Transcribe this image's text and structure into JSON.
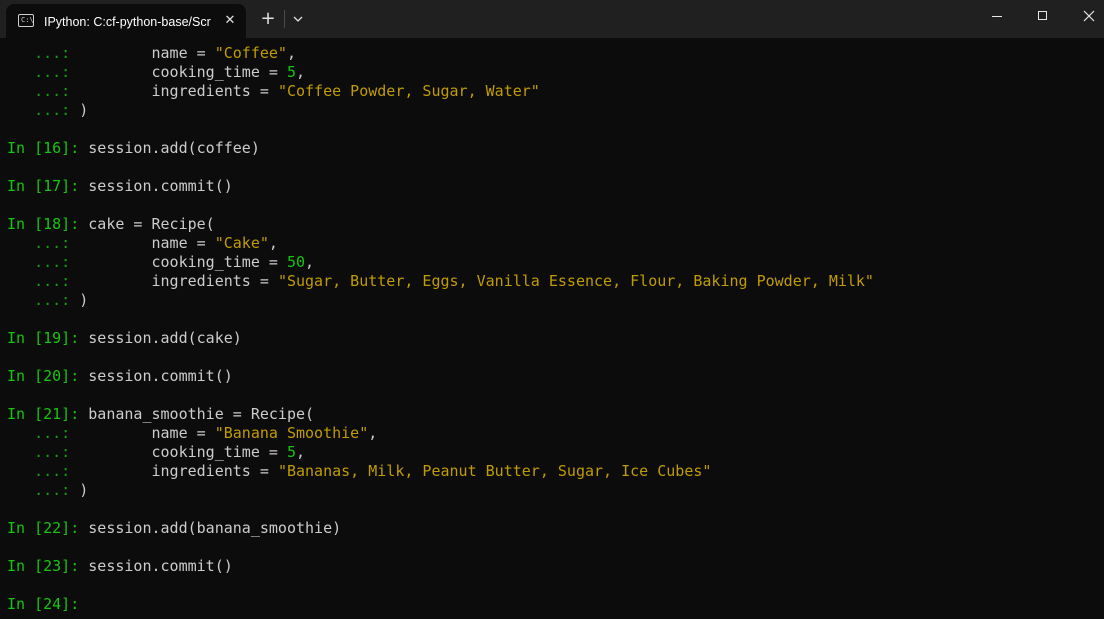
{
  "window": {
    "tab_title": "IPython: C:cf-python-base/Scr",
    "tab_icon": "terminal-icon",
    "new_tab_label": "+",
    "close_tab_label": "✕"
  },
  "terminal": {
    "lines": [
      {
        "segs": [
          {
            "t": "   ...: ",
            "c": "p-cont"
          },
          {
            "t": "        name = ",
            "c": "code"
          },
          {
            "t": "\"Coffee\"",
            "c": "str"
          },
          {
            "t": ",",
            "c": "code"
          }
        ]
      },
      {
        "segs": [
          {
            "t": "   ...: ",
            "c": "p-cont"
          },
          {
            "t": "        cooking_time = ",
            "c": "code"
          },
          {
            "t": "5",
            "c": "num"
          },
          {
            "t": ",",
            "c": "code"
          }
        ]
      },
      {
        "segs": [
          {
            "t": "   ...: ",
            "c": "p-cont"
          },
          {
            "t": "        ingredients = ",
            "c": "code"
          },
          {
            "t": "\"Coffee Powder, Sugar, Water\"",
            "c": "str"
          }
        ]
      },
      {
        "segs": [
          {
            "t": "   ...: ",
            "c": "p-cont"
          },
          {
            "t": ")",
            "c": "code"
          }
        ]
      },
      {
        "segs": []
      },
      {
        "segs": [
          {
            "t": "In [16]: ",
            "c": "p-in"
          },
          {
            "t": "session.add(coffee)",
            "c": "code"
          }
        ]
      },
      {
        "segs": []
      },
      {
        "segs": [
          {
            "t": "In [17]: ",
            "c": "p-in"
          },
          {
            "t": "session.commit()",
            "c": "code"
          }
        ]
      },
      {
        "segs": []
      },
      {
        "segs": [
          {
            "t": "In [18]: ",
            "c": "p-in"
          },
          {
            "t": "cake = Recipe(",
            "c": "code"
          }
        ]
      },
      {
        "segs": [
          {
            "t": "   ...: ",
            "c": "p-cont"
          },
          {
            "t": "        name = ",
            "c": "code"
          },
          {
            "t": "\"Cake\"",
            "c": "str"
          },
          {
            "t": ",",
            "c": "code"
          }
        ]
      },
      {
        "segs": [
          {
            "t": "   ...: ",
            "c": "p-cont"
          },
          {
            "t": "        cooking_time = ",
            "c": "code"
          },
          {
            "t": "50",
            "c": "num"
          },
          {
            "t": ",",
            "c": "code"
          }
        ]
      },
      {
        "segs": [
          {
            "t": "   ...: ",
            "c": "p-cont"
          },
          {
            "t": "        ingredients = ",
            "c": "code"
          },
          {
            "t": "\"Sugar, Butter, Eggs, Vanilla Essence, Flour, Baking Powder, Milk\"",
            "c": "str"
          }
        ]
      },
      {
        "segs": [
          {
            "t": "   ...: ",
            "c": "p-cont"
          },
          {
            "t": ")",
            "c": "code"
          }
        ]
      },
      {
        "segs": []
      },
      {
        "segs": [
          {
            "t": "In [19]: ",
            "c": "p-in"
          },
          {
            "t": "session.add(cake)",
            "c": "code"
          }
        ]
      },
      {
        "segs": []
      },
      {
        "segs": [
          {
            "t": "In [20]: ",
            "c": "p-in"
          },
          {
            "t": "session.commit()",
            "c": "code"
          }
        ]
      },
      {
        "segs": []
      },
      {
        "segs": [
          {
            "t": "In [21]: ",
            "c": "p-in"
          },
          {
            "t": "banana_smoothie = Recipe(",
            "c": "code"
          }
        ]
      },
      {
        "segs": [
          {
            "t": "   ...: ",
            "c": "p-cont"
          },
          {
            "t": "        name = ",
            "c": "code"
          },
          {
            "t": "\"Banana Smoothie\"",
            "c": "str"
          },
          {
            "t": ",",
            "c": "code"
          }
        ]
      },
      {
        "segs": [
          {
            "t": "   ...: ",
            "c": "p-cont"
          },
          {
            "t": "        cooking_time = ",
            "c": "code"
          },
          {
            "t": "5",
            "c": "num"
          },
          {
            "t": ",",
            "c": "code"
          }
        ]
      },
      {
        "segs": [
          {
            "t": "   ...: ",
            "c": "p-cont"
          },
          {
            "t": "        ingredients = ",
            "c": "code"
          },
          {
            "t": "\"Bananas, Milk, Peanut Butter, Sugar, Ice Cubes\"",
            "c": "str"
          }
        ]
      },
      {
        "segs": [
          {
            "t": "   ...: ",
            "c": "p-cont"
          },
          {
            "t": ")",
            "c": "code"
          }
        ]
      },
      {
        "segs": []
      },
      {
        "segs": [
          {
            "t": "In [22]: ",
            "c": "p-in"
          },
          {
            "t": "session.add(banana_smoothie)",
            "c": "code"
          }
        ]
      },
      {
        "segs": []
      },
      {
        "segs": [
          {
            "t": "In [23]: ",
            "c": "p-in"
          },
          {
            "t": "session.commit()",
            "c": "code"
          }
        ]
      },
      {
        "segs": []
      },
      {
        "segs": [
          {
            "t": "In [24]: ",
            "c": "p-in"
          }
        ]
      }
    ]
  },
  "colors": {
    "background": "#0c0c0c",
    "titlebar": "#202020",
    "prompt": "#16c60c",
    "continuation": "#13a10e",
    "string": "#c19c00",
    "number": "#16c60c",
    "text": "#cccccc"
  }
}
